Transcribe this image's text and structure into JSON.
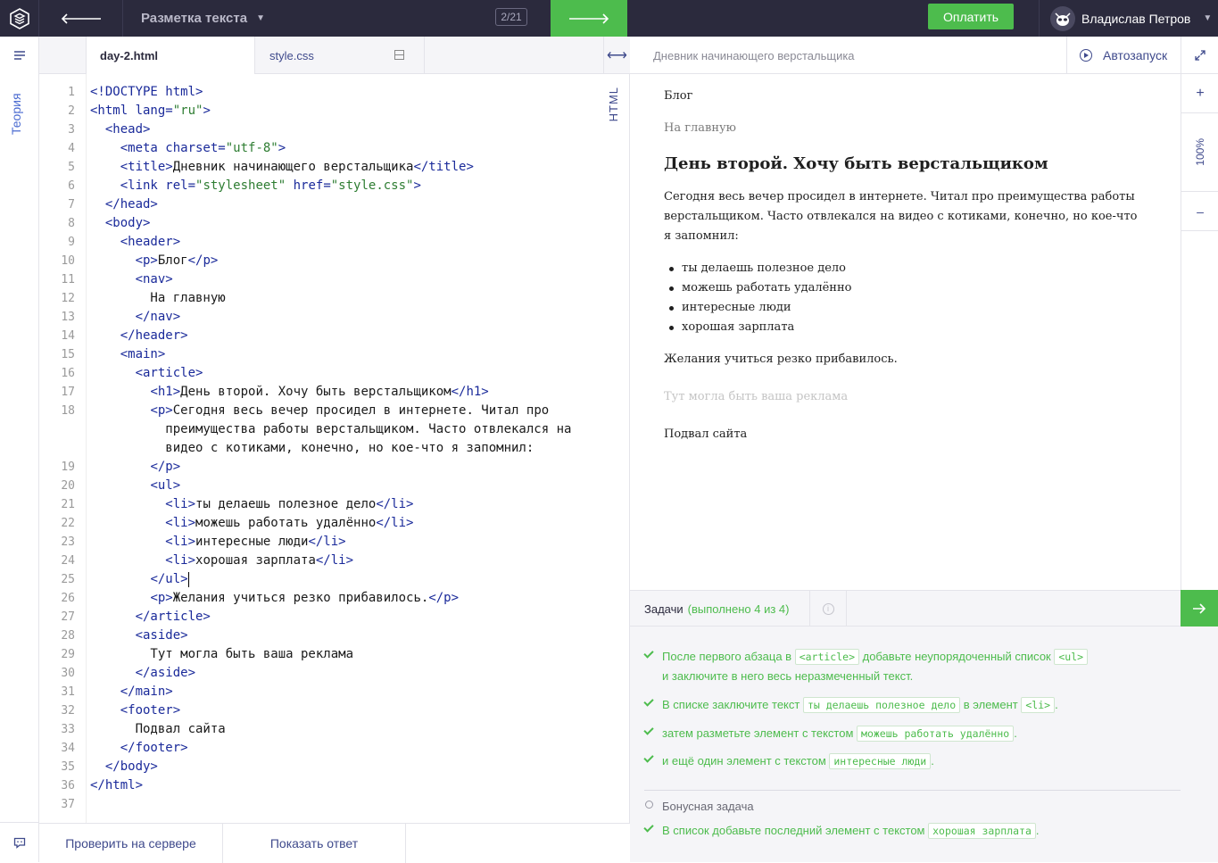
{
  "topbar": {
    "course_title": "Разметка текста",
    "counter": "2/21",
    "pay_label": "Оплатить",
    "user_name": "Владислав Петров"
  },
  "leftrail": {
    "theory_label": "Теория"
  },
  "editor": {
    "tabs": [
      "day-2.html",
      "style.css"
    ],
    "mode_label": "HTML",
    "lines": [
      {
        "n": "1",
        "html": "<span class=\"t\">&lt;!DOCTYPE html&gt;</span>"
      },
      {
        "n": "2",
        "html": "<span class=\"t\">&lt;html lang=</span><span class=\"s\">\"ru\"</span><span class=\"t\">&gt;</span>"
      },
      {
        "n": "3",
        "html": "  <span class=\"t\">&lt;head&gt;</span>"
      },
      {
        "n": "4",
        "html": "    <span class=\"t\">&lt;meta charset=</span><span class=\"s\">\"utf-8\"</span><span class=\"t\">&gt;</span>"
      },
      {
        "n": "5",
        "html": "    <span class=\"t\">&lt;title&gt;</span>Дневник начинающего верстальщика<span class=\"t\">&lt;/title&gt;</span>"
      },
      {
        "n": "6",
        "html": "    <span class=\"t\">&lt;link rel=</span><span class=\"s\">\"stylesheet\"</span><span class=\"t\"> href=</span><span class=\"s\">\"style.css\"</span><span class=\"t\">&gt;</span>"
      },
      {
        "n": "7",
        "html": "  <span class=\"t\">&lt;/head&gt;</span>"
      },
      {
        "n": "8",
        "html": "  <span class=\"t\">&lt;body&gt;</span>"
      },
      {
        "n": "9",
        "html": "    <span class=\"t\">&lt;header&gt;</span>"
      },
      {
        "n": "10",
        "html": "      <span class=\"t\">&lt;p&gt;</span>Блог<span class=\"t\">&lt;/p&gt;</span>"
      },
      {
        "n": "11",
        "html": "      <span class=\"t\">&lt;nav&gt;</span>"
      },
      {
        "n": "12",
        "html": "        На главную"
      },
      {
        "n": "13",
        "html": "      <span class=\"t\">&lt;/nav&gt;</span>"
      },
      {
        "n": "14",
        "html": "    <span class=\"t\">&lt;/header&gt;</span>"
      },
      {
        "n": "15",
        "html": "    <span class=\"t\">&lt;main&gt;</span>"
      },
      {
        "n": "16",
        "html": "      <span class=\"t\">&lt;article&gt;</span>"
      },
      {
        "n": "17",
        "html": "        <span class=\"t\">&lt;h1&gt;</span>День второй. Хочу быть верстальщиком<span class=\"t\">&lt;/h1&gt;</span>"
      },
      {
        "n": "18",
        "html": "        <span class=\"t\">&lt;p&gt;</span>Сегодня весь вечер просидел в интернете. Читал про"
      },
      {
        "n": "",
        "html": "          преимущества работы верстальщиком. Часто отвлекался на"
      },
      {
        "n": "",
        "html": "          видео с котиками, конечно, но кое-что я запомнил:"
      },
      {
        "n": "19",
        "html": "        <span class=\"t\">&lt;/p&gt;</span>"
      },
      {
        "n": "20",
        "html": "        <span class=\"t\">&lt;ul&gt;</span>"
      },
      {
        "n": "21",
        "html": "          <span class=\"t\">&lt;li&gt;</span>ты делаешь полезное дело<span class=\"t\">&lt;/li&gt;</span>"
      },
      {
        "n": "22",
        "html": "          <span class=\"t\">&lt;li&gt;</span>можешь работать удалённо<span class=\"t\">&lt;/li&gt;</span>"
      },
      {
        "n": "23",
        "html": "          <span class=\"t\">&lt;li&gt;</span>интересные люди<span class=\"t\">&lt;/li&gt;</span>"
      },
      {
        "n": "24",
        "html": "          <span class=\"t\">&lt;li&gt;</span>хорошая зарплата<span class=\"t\">&lt;/li&gt;</span>"
      },
      {
        "n": "25",
        "html": "        <span class=\"t\">&lt;/ul&gt;</span><span class=\"cursor\"></span>"
      },
      {
        "n": "26",
        "html": "        <span class=\"t\">&lt;p&gt;</span>Желания учиться резко прибавилось.<span class=\"t\">&lt;/p&gt;</span>"
      },
      {
        "n": "27",
        "html": "      <span class=\"t\">&lt;/article&gt;</span>"
      },
      {
        "n": "28",
        "html": "      <span class=\"t\">&lt;aside&gt;</span>"
      },
      {
        "n": "29",
        "html": "        Тут могла быть ваша реклама"
      },
      {
        "n": "30",
        "html": "      <span class=\"t\">&lt;/aside&gt;</span>"
      },
      {
        "n": "31",
        "html": "    <span class=\"t\">&lt;/main&gt;</span>"
      },
      {
        "n": "32",
        "html": "    <span class=\"t\">&lt;footer&gt;</span>"
      },
      {
        "n": "33",
        "html": "      Подвал сайта"
      },
      {
        "n": "34",
        "html": "    <span class=\"t\">&lt;/footer&gt;</span>"
      },
      {
        "n": "35",
        "html": "  <span class=\"t\">&lt;/body&gt;</span>"
      },
      {
        "n": "36",
        "html": "<span class=\"t\">&lt;/html&gt;</span>"
      },
      {
        "n": "37",
        "html": ""
      }
    ],
    "check_label": "Проверить на сервере",
    "answer_label": "Показать ответ"
  },
  "preview": {
    "page_title": "Дневник начинающего верстальщика",
    "autorun_label": "Автозапуск",
    "zoom": "100%",
    "zoom_in": "+",
    "zoom_out": "–",
    "blog": "Блог",
    "nav": "На главную",
    "heading": "День второй. Хочу быть верстальщиком",
    "paragraph": "Сегодня весь вечер просидел в интернете. Читал про преимущества работы верстальщиком. Часто отвлекался на видео с котиками, конечно, но кое-что я запомнил:",
    "list": [
      "ты делаешь полезное дело",
      "можешь работать удалённо",
      "интересные люди",
      "хорошая зарплата"
    ],
    "closing": "Желания учиться резко прибавилось.",
    "aside": "Тут могла быть ваша реклама",
    "footer": "Подвал сайта"
  },
  "tasks": {
    "label": "Задачи",
    "status": "(выполнено 4 из 4)",
    "items": [
      "После первого абзаца в <span class=\"code-chip\">&lt;article&gt;</span> добавьте неупорядоченный список <span class=\"code-chip\">&lt;ul&gt;</span><br>и заключите в него весь неразмеченный текст.",
      "В списке заключите текст <span class=\"code-chip\">ты делаешь полезное дело</span> в элемент <span class=\"code-chip\">&lt;li&gt;</span>.",
      "затем разметьте элемент с текстом <span class=\"code-chip\">можешь работать удалённо</span>.",
      "и ещё один элемент с текстом <span class=\"code-chip\">интересные люди</span>."
    ],
    "bonus_label": "Бонусная задача",
    "bonus_item": "В список добавьте последний элемент с текстом <span class=\"code-chip\">хорошая зарплата</span>."
  }
}
